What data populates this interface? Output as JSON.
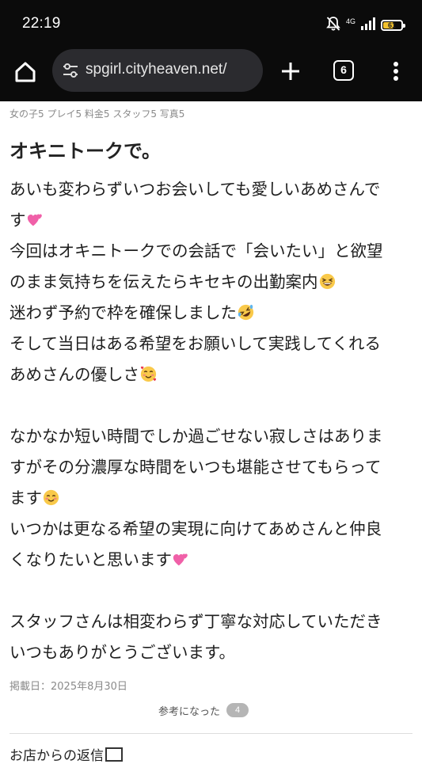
{
  "status_bar": {
    "time": "22:19",
    "network": "4G",
    "battery_level": "61",
    "battery_fraction": 0.61,
    "icons": [
      "mute-bell-icon",
      "signal-icon",
      "battery-icon"
    ]
  },
  "browser": {
    "url": "spgirl.cityheaven.net/",
    "tab_count": "6",
    "icons": [
      "home-icon",
      "tune-icon",
      "plus-icon",
      "tabs-icon",
      "more-vert-icon"
    ]
  },
  "review": {
    "ratings": "女の子5 プレイ5 料金5 スタッフ5 写真5",
    "title": "オキニトークで。",
    "lines": [
      "あいも変わらずいつお会いしても愛しいあめさんで",
      "す",
      "今回はオキニトークでの会話で「会いたい」と欲望",
      "のまま気持ちを伝えたらキセキの出勤案内",
      "迷わず予約で枠を確保しました",
      "そして当日はある希望をお願いして実践してくれる",
      "あめさんの優しさ",
      "",
      "なかなか短い時間でしか過ごせない寂しさはありま",
      "すがその分濃厚な時間をいつも堪能させてもらって",
      "ます",
      "いつかは更なる希望の実現に向けてあめさんと仲良",
      "くなりたいと思います",
      "",
      "スタッフさんは相変わらず丁寧な対応していただき",
      "いつもありがとうございます。"
    ],
    "emojis": {
      "line1": "two-hearts-icon",
      "line3": "grinning-squinting-icon",
      "line4": "rolling-laughing-icon",
      "line6": "smiling-hearts-icon",
      "line10": "smiling-blush-icon",
      "line12": "two-hearts-icon"
    },
    "posted_date": "掲載日：2025年8月30日",
    "helpful_label": "参考になった",
    "helpful_count": "4"
  },
  "shop_reply": {
    "label": "お店からの返信"
  },
  "colors": {
    "bar_background": "#0b0b0b",
    "url_pill": "#2b2b2f",
    "battery": "#f2c12e",
    "muted_text": "#8a8a8a"
  }
}
